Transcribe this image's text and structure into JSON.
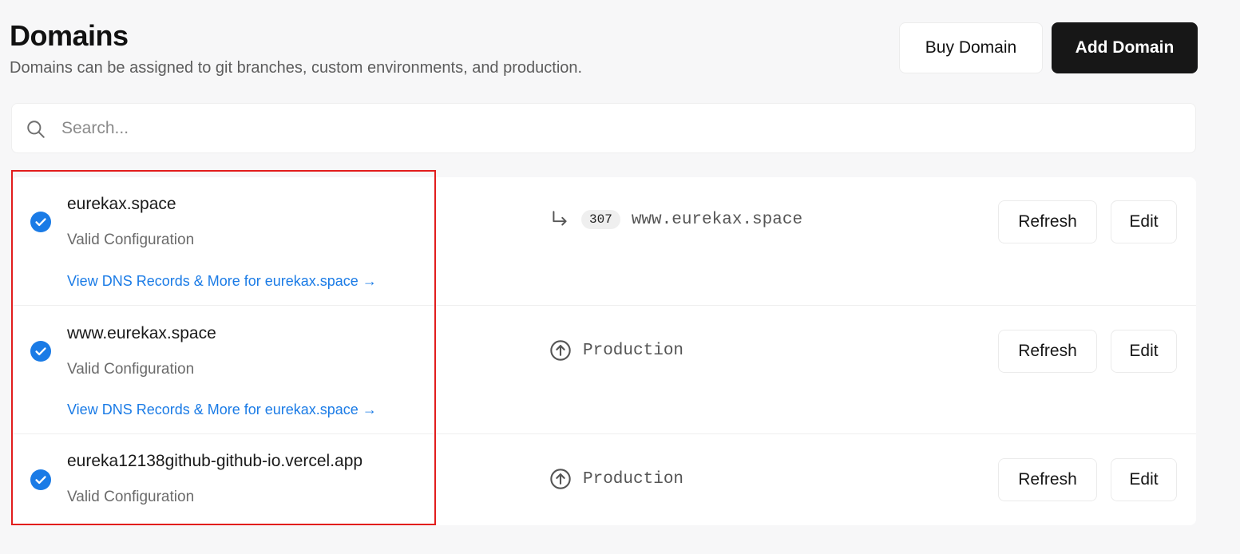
{
  "header": {
    "title": "Domains",
    "subtitle": "Domains can be assigned to git branches, custom environments, and production.",
    "buy_label": "Buy Domain",
    "add_label": "Add Domain"
  },
  "search": {
    "placeholder": "Search..."
  },
  "domains": [
    {
      "name": "eurekax.space",
      "status": "Valid Configuration",
      "link": "View DNS Records & More for eurekax.space →",
      "redirect_code": "307",
      "target": "www.eurekax.space",
      "refresh_label": "Refresh",
      "edit_label": "Edit"
    },
    {
      "name": "www.eurekax.space",
      "status": "Valid Configuration",
      "link": "View DNS Records & More for eurekax.space →",
      "target": "Production",
      "refresh_label": "Refresh",
      "edit_label": "Edit"
    },
    {
      "name": "eureka12138github-github-io.vercel.app",
      "status": "Valid Configuration",
      "target": "Production",
      "refresh_label": "Refresh",
      "edit_label": "Edit"
    }
  ],
  "colors": {
    "accent_blue": "#1a7be6",
    "primary_button": "#171717",
    "highlight_border": "#e21d1d"
  },
  "icons": {
    "search": "search-icon",
    "check": "check-circle-icon",
    "redirect": "redirect-arrow-icon",
    "production": "arrow-up-circle-icon"
  }
}
